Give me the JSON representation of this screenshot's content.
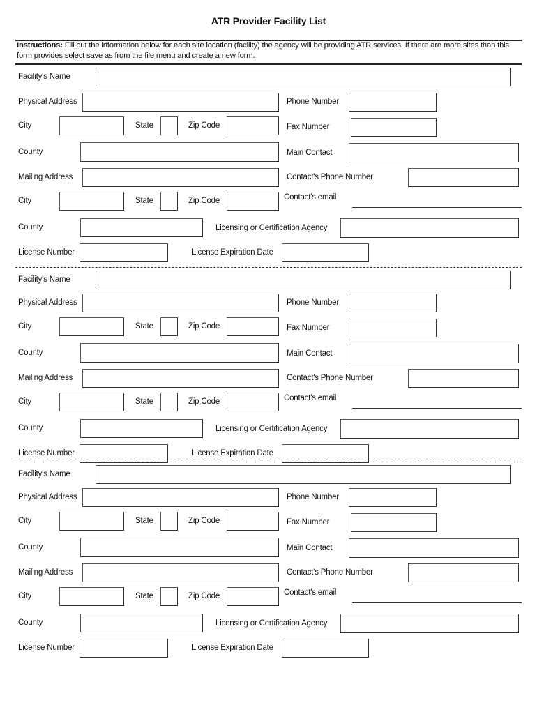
{
  "title": "ATR Provider Facility List",
  "instructions": {
    "label": "Instructions:",
    "text": " Fill out the information below for each site location (facility) the agency will be providing ATR services.  If there are more sites than this form provides select save as from the file menu and create a new form."
  },
  "labels": {
    "facility_name": "Facility's Name",
    "physical_address": "Physical Address",
    "phone_number": "Phone Number",
    "city": "City",
    "state": "State",
    "zip_code": "Zip Code",
    "fax_number": "Fax Number",
    "county": "County",
    "main_contact": "Main Contact",
    "mailing_address": "Mailing Address",
    "contacts_phone": "Contact's Phone Number",
    "contacts_email": "Contact's email",
    "licensing_agency": "Licensing or Certification Agency",
    "license_number": "License Number",
    "license_expiration": "License Expiration Date"
  },
  "facilities": [
    {
      "facility_name": "",
      "physical_address": "",
      "phone_number": "",
      "city": "",
      "state": "",
      "zip_code": "",
      "fax_number": "",
      "county": "",
      "main_contact": "",
      "mailing_address": "",
      "contacts_phone": "",
      "mailing_city": "",
      "mailing_state": "",
      "mailing_zip": "",
      "contacts_email": "",
      "mailing_county": "",
      "licensing_agency": "",
      "license_number": "",
      "license_expiration": ""
    },
    {
      "facility_name": "",
      "physical_address": "",
      "phone_number": "",
      "city": "",
      "state": "",
      "zip_code": "",
      "fax_number": "",
      "county": "",
      "main_contact": "",
      "mailing_address": "",
      "contacts_phone": "",
      "mailing_city": "",
      "mailing_state": "",
      "mailing_zip": "",
      "contacts_email": "",
      "mailing_county": "",
      "licensing_agency": "",
      "license_number": "",
      "license_expiration": ""
    },
    {
      "facility_name": "",
      "physical_address": "",
      "phone_number": "",
      "city": "",
      "state": "",
      "zip_code": "",
      "fax_number": "",
      "county": "",
      "main_contact": "",
      "mailing_address": "",
      "contacts_phone": "",
      "mailing_city": "",
      "mailing_state": "",
      "mailing_zip": "",
      "contacts_email": "",
      "mailing_county": "",
      "licensing_agency": "",
      "license_number": "",
      "license_expiration": ""
    }
  ]
}
